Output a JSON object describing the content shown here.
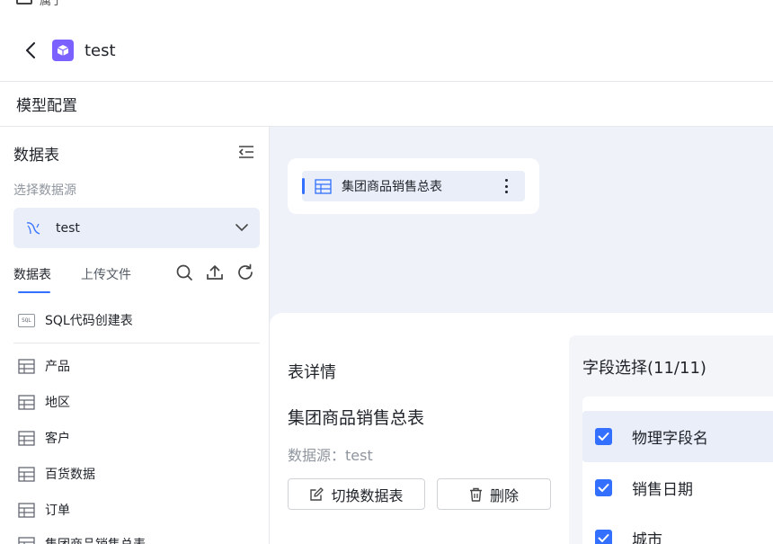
{
  "top_partial": {
    "label": "属于"
  },
  "header": {
    "title": "test"
  },
  "page": {
    "section_title": "模型配置"
  },
  "sidebar": {
    "title": "数据表",
    "datasource_hint": "选择数据源",
    "datasource_selected": "test",
    "tabs": [
      {
        "label": "数据表",
        "active": true
      },
      {
        "label": "上传文件",
        "active": false
      }
    ],
    "sql_create_label": "SQL代码创建表",
    "sql_badge": "SQL",
    "tables": [
      {
        "label": "产品"
      },
      {
        "label": "地区"
      },
      {
        "label": "客户"
      },
      {
        "label": "百货数据"
      },
      {
        "label": "订单"
      },
      {
        "label": "集团商品销售总表",
        "selected": true
      }
    ]
  },
  "canvas": {
    "node_label": "集团商品销售总表"
  },
  "detail": {
    "title": "表详情",
    "table_name": "集团商品销售总表",
    "source_text": "数据源：test",
    "switch_button": "切换数据表",
    "delete_button": "删除"
  },
  "fields": {
    "title": "字段选择(11/11)",
    "items": [
      {
        "label": "物理字段名",
        "checked": true,
        "header": true
      },
      {
        "label": "销售日期",
        "checked": true
      },
      {
        "label": "城市",
        "checked": true
      }
    ]
  },
  "colors": {
    "accent": "#3370ff",
    "app_icon": "#7b61ff",
    "canvas_bg": "#eff2f9",
    "selected_bg": "#e9eef8",
    "success": "#34c724"
  }
}
